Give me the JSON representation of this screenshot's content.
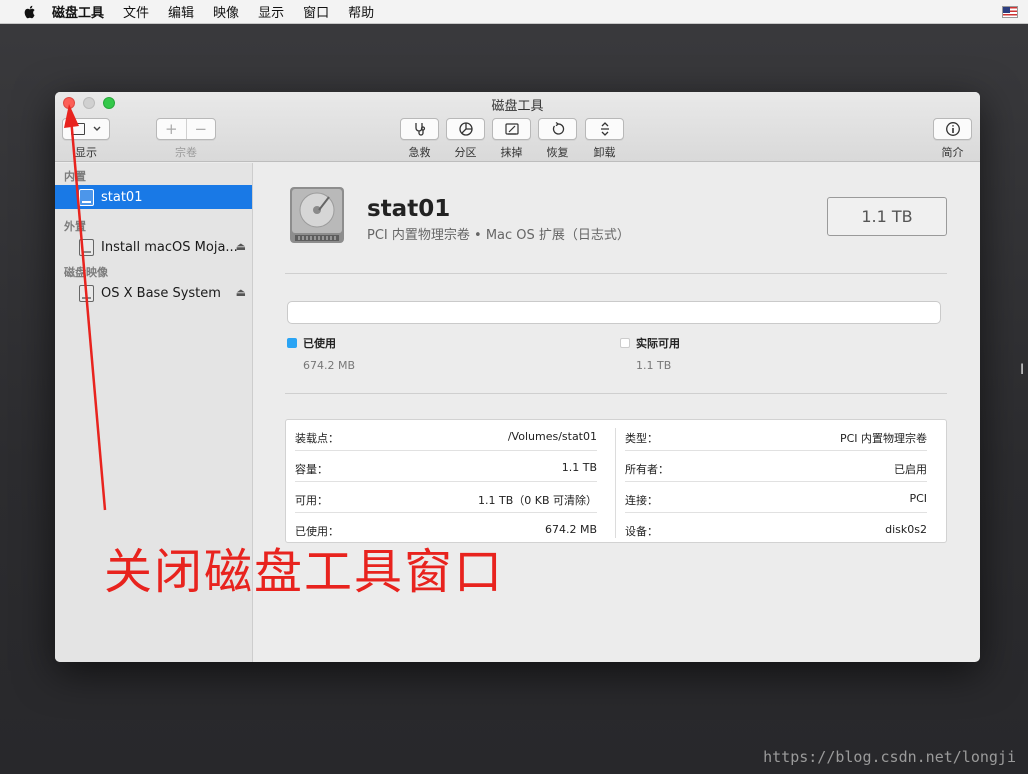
{
  "menubar": {
    "items": [
      "磁盘工具",
      "文件",
      "编辑",
      "映像",
      "显示",
      "窗口",
      "帮助"
    ]
  },
  "window": {
    "title": "磁盘工具",
    "toolbar": {
      "view_label": "显示",
      "volume_label": "宗卷",
      "volume_add": "+",
      "volume_remove": "−",
      "first_aid_label": "急救",
      "partition_label": "分区",
      "erase_label": "抹掉",
      "restore_label": "恢复",
      "unmount_label": "卸载",
      "info_label": "简介"
    }
  },
  "sidebar": {
    "sections": [
      {
        "title": "内置",
        "items": [
          {
            "label": "stat01",
            "selected": true,
            "ejectable": false
          }
        ]
      },
      {
        "title": "外置",
        "items": [
          {
            "label": "Install macOS Moja...",
            "selected": false,
            "ejectable": true
          }
        ]
      },
      {
        "title": "磁盘映像",
        "items": [
          {
            "label": "OS X Base System",
            "selected": false,
            "ejectable": true
          }
        ]
      }
    ],
    "eject_glyph": "⏏"
  },
  "volume": {
    "name": "stat01",
    "description": "PCI 内置物理宗卷 • Mac OS 扩展（日志式）",
    "size": "1.1 TB",
    "usage_fraction": 0.0,
    "used_label": "已使用",
    "used_value": "674.2 MB",
    "used_color": "#2aa4f4",
    "available_label": "实际可用",
    "available_value": "1.1 TB",
    "available_color": "#ffffff"
  },
  "info": {
    "left": [
      {
        "key": "装载点：",
        "value": "/Volumes/stat01"
      },
      {
        "key": "容量：",
        "value": "1.1 TB"
      },
      {
        "key": "可用：",
        "value": "1.1 TB（0 KB 可清除）"
      },
      {
        "key": "已使用：",
        "value": "674.2 MB"
      }
    ],
    "right": [
      {
        "key": "类型：",
        "value": "PCI 内置物理宗卷"
      },
      {
        "key": "所有者：",
        "value": "已启用"
      },
      {
        "key": "连接：",
        "value": "PCI"
      },
      {
        "key": "设备：",
        "value": "disk0s2"
      }
    ]
  },
  "annotation": {
    "text": "关闭磁盘工具窗口",
    "color": "#e8231e"
  },
  "watermark": "https://blog.csdn.net/longji"
}
